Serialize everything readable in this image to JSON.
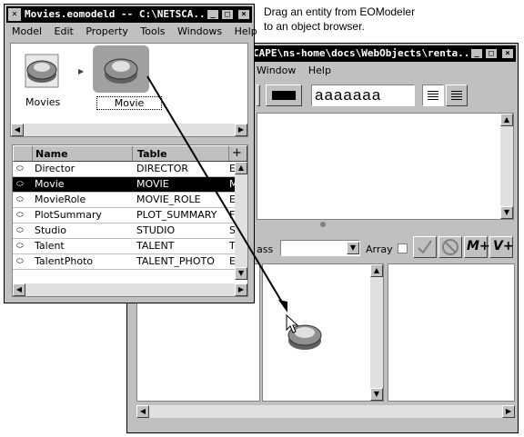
{
  "caption": {
    "line1": "Drag an entity from EOModeler",
    "line2": "to an object browser."
  },
  "back_window": {
    "title": "CAPE\\ns-home\\docs\\WebObjects\\renta...",
    "menu": [
      "Window",
      "Help"
    ],
    "font_sample": "aaaaaaa",
    "class_label": "ass",
    "array_label": "Array",
    "tool_buttons": [
      "check-icon",
      "no-icon",
      "M+",
      "V+"
    ]
  },
  "front_window": {
    "title": "Movies.eomodeld  --  C:\\NETSCA...",
    "menu": [
      "Model",
      "Edit",
      "Property",
      "Tools",
      "Windows",
      "Help"
    ],
    "icons": [
      {
        "label": "Movies"
      },
      {
        "label": "Movie"
      }
    ],
    "table": {
      "headers": [
        "Name",
        "Table"
      ],
      "rows": [
        {
          "name": "Director",
          "table": "DIRECTOR",
          "extra": "E"
        },
        {
          "name": "Movie",
          "table": "MOVIE",
          "extra": "M"
        },
        {
          "name": "MovieRole",
          "table": "MOVIE_ROLE",
          "extra": "E"
        },
        {
          "name": "PlotSummary",
          "table": "PLOT_SUMMARY",
          "extra": "F"
        },
        {
          "name": "Studio",
          "table": "STUDIO",
          "extra": "S"
        },
        {
          "name": "Talent",
          "table": "TALENT",
          "extra": "T"
        },
        {
          "name": "TalentPhoto",
          "table": "TALENT_PHOTO",
          "extra": "E"
        }
      ],
      "selected_index": 1
    }
  },
  "colors": {
    "title_bg": "#000000",
    "chrome": "#c0c0c0",
    "selection": "#000000"
  }
}
